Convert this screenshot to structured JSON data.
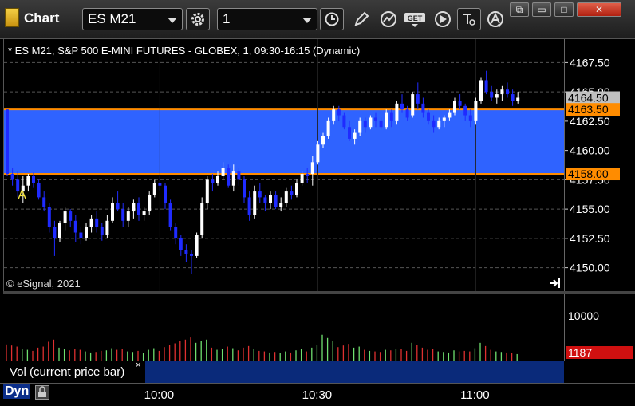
{
  "window": {
    "title": "Chart",
    "symbol": "ES M21",
    "interval": "1",
    "controls": {
      "restore": "⧉",
      "minimize": "▭",
      "maximize": "□",
      "close": "✕"
    }
  },
  "chart": {
    "header": "* ES M21, S&P 500 E-MINI FUTURES - GLOBEX, 1, 09:30-16:15 (Dynamic)",
    "copyright": "© eSignal, 2021",
    "annotation": "A",
    "current_price_label": "4164.50",
    "zone_upper_label": "4163.50",
    "zone_lower_label": "4158.00",
    "volume_label": "Vol (current price bar)",
    "volume_close": "×",
    "volume_tick": "10000",
    "volume_value": "1187",
    "dyn_label": "Dyn",
    "colors": {
      "zone": "#2f63ff",
      "zone_border": "#ff8c00",
      "up": "#ffffff",
      "down": "#1f2bff",
      "vol_up": "#6fe06f",
      "vol_down": "#e03030",
      "current": "#c0c0c0",
      "vol_value_bg": "#d01010"
    }
  },
  "chart_data": {
    "type": "candlestick",
    "ylim": [
      4148.0,
      4169.5
    ],
    "yticks": [
      4167.5,
      4165.0,
      4162.5,
      4160.0,
      4157.5,
      4155.0,
      4152.5,
      4150.0
    ],
    "ytick_labels": [
      "4167.50",
      "4165.00",
      "4162.50",
      "4160.00",
      "4157.50",
      "4155.00",
      "4152.50",
      "4150.00"
    ],
    "zone": [
      4158.0,
      4163.5
    ],
    "current_price": 4164.5,
    "x_ticks": [
      "10:00",
      "10:30",
      "11:00"
    ],
    "x_tick_bars": [
      29,
      59,
      89
    ],
    "bars": [
      [
        4163.5,
        4163.5,
        4157.8,
        4158.0,
        3000
      ],
      [
        4158.0,
        4158.5,
        4157.0,
        4157.5,
        2800
      ],
      [
        4157.5,
        4158.2,
        4156.0,
        4156.5,
        2600
      ],
      [
        4156.5,
        4157.8,
        4155.5,
        4157.0,
        2200
      ],
      [
        4157.0,
        4158.0,
        4156.5,
        4157.8,
        2000
      ],
      [
        4157.8,
        4158.1,
        4156.8,
        4157.2,
        1800
      ],
      [
        4157.2,
        4157.5,
        4155.8,
        4156.0,
        2400
      ],
      [
        4156.0,
        4156.5,
        4154.8,
        4155.2,
        2600
      ],
      [
        4155.2,
        4155.5,
        4153.0,
        4153.5,
        3500
      ],
      [
        4153.5,
        4154.0,
        4151.0,
        4152.5,
        3900
      ],
      [
        4152.5,
        4154.0,
        4152.2,
        4153.8,
        2400
      ],
      [
        4153.8,
        4155.2,
        4153.2,
        4154.8,
        2100
      ],
      [
        4154.8,
        4155.0,
        4153.5,
        4154.0,
        1900
      ],
      [
        4154.0,
        4154.5,
        4152.2,
        4153.0,
        2200
      ],
      [
        4153.0,
        4153.5,
        4152.0,
        4152.5,
        2000
      ],
      [
        4152.5,
        4153.8,
        4152.3,
        4153.5,
        1700
      ],
      [
        4153.5,
        4154.5,
        4153.0,
        4154.2,
        1500
      ],
      [
        4154.2,
        4154.8,
        4153.0,
        4153.5,
        1600
      ],
      [
        4153.5,
        4153.8,
        4152.3,
        4152.8,
        1800
      ],
      [
        4152.8,
        4154.5,
        4152.5,
        4154.0,
        1900
      ],
      [
        4154.0,
        4156.0,
        4153.8,
        4155.5,
        2300
      ],
      [
        4155.5,
        4156.5,
        4154.8,
        4155.0,
        2000
      ],
      [
        4155.0,
        4155.5,
        4153.5,
        4154.0,
        2100
      ],
      [
        4154.0,
        4155.2,
        4153.5,
        4154.8,
        1700
      ],
      [
        4154.8,
        4155.8,
        4154.2,
        4155.5,
        1600
      ],
      [
        4155.5,
        4156.0,
        4154.0,
        4154.5,
        1800
      ],
      [
        4154.5,
        4155.2,
        4154.0,
        4154.8,
        1400
      ],
      [
        4154.8,
        4156.5,
        4154.5,
        4156.2,
        2000
      ],
      [
        4156.2,
        4157.5,
        4156.0,
        4157.2,
        2300
      ],
      [
        4157.2,
        4157.8,
        4156.5,
        4157.0,
        1800
      ],
      [
        4157.0,
        4157.2,
        4155.0,
        4155.5,
        2500
      ],
      [
        4155.5,
        4155.8,
        4153.2,
        4153.5,
        2900
      ],
      [
        4153.5,
        4153.8,
        4152.0,
        4152.5,
        3200
      ],
      [
        4152.5,
        4152.8,
        4151.0,
        4151.5,
        3600
      ],
      [
        4151.5,
        4152.0,
        4150.5,
        4151.2,
        3900
      ],
      [
        4151.2,
        4151.5,
        4149.5,
        4151.0,
        4300
      ],
      [
        4151.0,
        4153.0,
        4150.8,
        4152.8,
        3300
      ],
      [
        4152.8,
        4156.0,
        4152.5,
        4155.5,
        3600
      ],
      [
        4155.5,
        4157.8,
        4155.0,
        4157.5,
        3900
      ],
      [
        4157.5,
        4158.0,
        4156.5,
        4157.2,
        2400
      ],
      [
        4157.2,
        4158.2,
        4157.0,
        4157.8,
        2000
      ],
      [
        4157.8,
        4159.0,
        4157.5,
        4158.5,
        2200
      ],
      [
        4158.5,
        4158.8,
        4156.8,
        4157.0,
        2600
      ],
      [
        4157.0,
        4158.8,
        4156.5,
        4158.2,
        2300
      ],
      [
        4158.2,
        4158.5,
        4157.0,
        4157.5,
        1900
      ],
      [
        4157.5,
        4157.8,
        4155.5,
        4156.0,
        2400
      ],
      [
        4156.0,
        4156.5,
        4154.0,
        4154.5,
        2700
      ],
      [
        4154.5,
        4157.0,
        4154.2,
        4156.5,
        2200
      ],
      [
        4156.5,
        4157.2,
        4155.5,
        4156.0,
        1800
      ],
      [
        4156.0,
        4156.2,
        4154.8,
        4155.5,
        1700
      ],
      [
        4155.5,
        4156.5,
        4155.0,
        4156.2,
        1500
      ],
      [
        4156.2,
        4156.5,
        4155.0,
        4155.2,
        1600
      ],
      [
        4155.2,
        4156.0,
        4154.8,
        4155.5,
        1400
      ],
      [
        4155.5,
        4156.8,
        4155.2,
        4156.5,
        1700
      ],
      [
        4156.5,
        4157.0,
        4155.8,
        4156.2,
        1500
      ],
      [
        4156.2,
        4157.5,
        4156.0,
        4157.2,
        1900
      ],
      [
        4157.2,
        4158.2,
        4157.0,
        4158.0,
        2100
      ],
      [
        4158.0,
        4158.5,
        4157.2,
        4157.8,
        1700
      ],
      [
        4158.0,
        4159.5,
        4157.0,
        4159.0,
        2400
      ],
      [
        4159.0,
        4160.8,
        4158.8,
        4160.5,
        2900
      ],
      [
        4160.5,
        4161.5,
        4160.2,
        4161.2,
        4800
      ],
      [
        4161.2,
        4162.8,
        4161.0,
        4162.5,
        4200
      ],
      [
        4162.5,
        4163.8,
        4162.2,
        4163.5,
        3700
      ],
      [
        4163.5,
        4163.8,
        4162.5,
        4163.0,
        2500
      ],
      [
        4163.0,
        4163.2,
        4161.8,
        4162.0,
        2800
      ],
      [
        4162.0,
        4162.5,
        4160.8,
        4161.0,
        3100
      ],
      [
        4161.0,
        4161.8,
        4160.5,
        4161.5,
        2400
      ],
      [
        4161.5,
        4162.8,
        4161.2,
        4162.5,
        2600
      ],
      [
        4162.5,
        4162.8,
        4161.5,
        4162.0,
        2000
      ],
      [
        4162.0,
        4163.0,
        4161.8,
        4162.8,
        1800
      ],
      [
        4162.8,
        4163.2,
        4162.0,
        4162.5,
        1700
      ],
      [
        4162.5,
        4162.8,
        4161.8,
        4162.0,
        1600
      ],
      [
        4162.0,
        4163.5,
        4161.8,
        4163.2,
        2000
      ],
      [
        4163.2,
        4163.5,
        4162.0,
        4162.5,
        1900
      ],
      [
        4162.5,
        4164.2,
        4162.2,
        4164.0,
        2200
      ],
      [
        4164.0,
        4164.8,
        4163.2,
        4163.5,
        2100
      ],
      [
        4163.5,
        4163.8,
        4162.5,
        4162.8,
        1800
      ],
      [
        4163.0,
        4165.0,
        4162.8,
        4164.8,
        3300
      ],
      [
        4164.8,
        4165.8,
        4163.5,
        4164.0,
        2900
      ],
      [
        4164.0,
        4164.5,
        4162.8,
        4163.2,
        2400
      ],
      [
        4163.2,
        4163.5,
        4162.2,
        4162.5,
        2000
      ],
      [
        4162.5,
        4163.0,
        4161.5,
        4162.0,
        2200
      ],
      [
        4162.0,
        4162.8,
        4161.8,
        4162.5,
        1700
      ],
      [
        4162.5,
        4163.0,
        4162.0,
        4162.8,
        1600
      ],
      [
        4162.8,
        4163.5,
        4162.5,
        4163.2,
        1500
      ],
      [
        4163.2,
        4164.5,
        4163.0,
        4164.2,
        1900
      ],
      [
        4164.2,
        4164.8,
        4163.5,
        4163.8,
        1700
      ],
      [
        4163.8,
        4164.0,
        4162.5,
        4163.0,
        1800
      ],
      [
        4163.0,
        4163.5,
        4162.0,
        4162.5,
        1700
      ],
      [
        4162.5,
        4164.5,
        4162.2,
        4164.2,
        2300
      ],
      [
        4164.2,
        4166.2,
        4164.0,
        4166.0,
        3300
      ],
      [
        4166.0,
        4166.8,
        4164.8,
        4165.0,
        2700
      ],
      [
        4165.0,
        4165.5,
        4164.2,
        4164.5,
        2000
      ],
      [
        4164.5,
        4165.2,
        4164.0,
        4164.8,
        1700
      ],
      [
        4164.8,
        4165.5,
        4164.2,
        4165.2,
        1600
      ],
      [
        4165.2,
        4165.8,
        4164.5,
        4164.8,
        1500
      ],
      [
        4164.8,
        4165.2,
        4163.8,
        4164.2,
        1400
      ],
      [
        4164.2,
        4165.0,
        4164.0,
        4164.5,
        1200
      ]
    ]
  }
}
